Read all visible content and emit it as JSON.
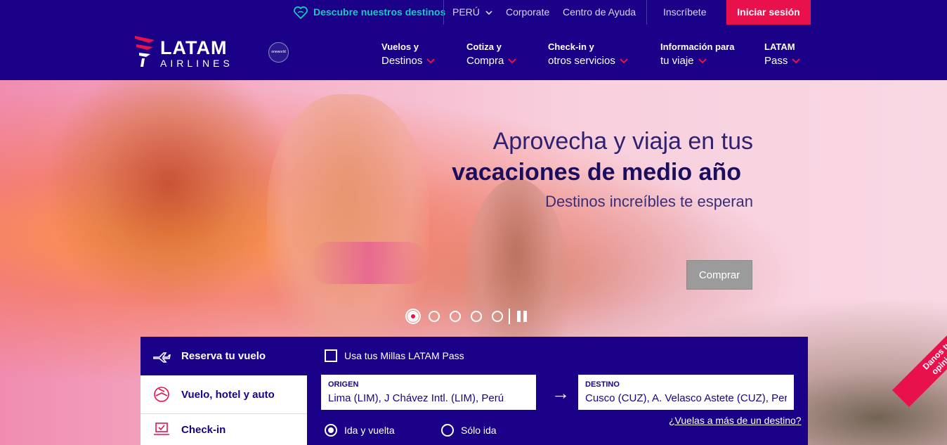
{
  "topbar": {
    "discover": "Descubre nuestros destinos",
    "country": "PERÚ",
    "corporate": "Corporate",
    "help": "Centro de Ayuda",
    "register": "Inscríbete",
    "login": "Iniciar sesión"
  },
  "logo": {
    "line1": "LATAM",
    "line2": "AIRLINES",
    "partner": "oneworld"
  },
  "menu": [
    {
      "line1": "Vuelos y",
      "line2": "Destinos"
    },
    {
      "line1": "Cotiza y",
      "line2": "Compra"
    },
    {
      "line1": "Check-in y",
      "line2": "otros servicios"
    },
    {
      "line1": "Información para",
      "line2": "tu viaje"
    },
    {
      "line1": "LATAM",
      "line2": "Pass"
    }
  ],
  "hero": {
    "headline1": "Aprovecha y viaja en tus",
    "headline2": "vacaciones de medio año",
    "headline3": "Destinos increíbles te esperan",
    "cta": "Comprar",
    "slides_total": 5,
    "active_slide": 1
  },
  "booking": {
    "tabs": [
      "Reserva tu vuelo",
      "Vuelo, hotel y auto",
      "Check-in"
    ],
    "miles_label": "Usa tus Millas LATAM Pass",
    "origin_label": "ORIGEN",
    "origin_value": "Lima (LIM), J Chávez Intl. (LIM), Perú",
    "dest_label": "DESTINO",
    "dest_value": "Cusco (CUZ), A. Velasco Astete (CUZ), Perú",
    "roundtrip": "Ida y vuelta",
    "oneway": "Sólo ida",
    "multi_dest": "¿Vuelas a más de un destino?"
  },
  "feedback": {
    "line1": "Danos tu",
    "line2": "opinión"
  },
  "colors": {
    "brand": "#1b0088",
    "accent": "#e8114b",
    "teal": "#19c9c0"
  }
}
